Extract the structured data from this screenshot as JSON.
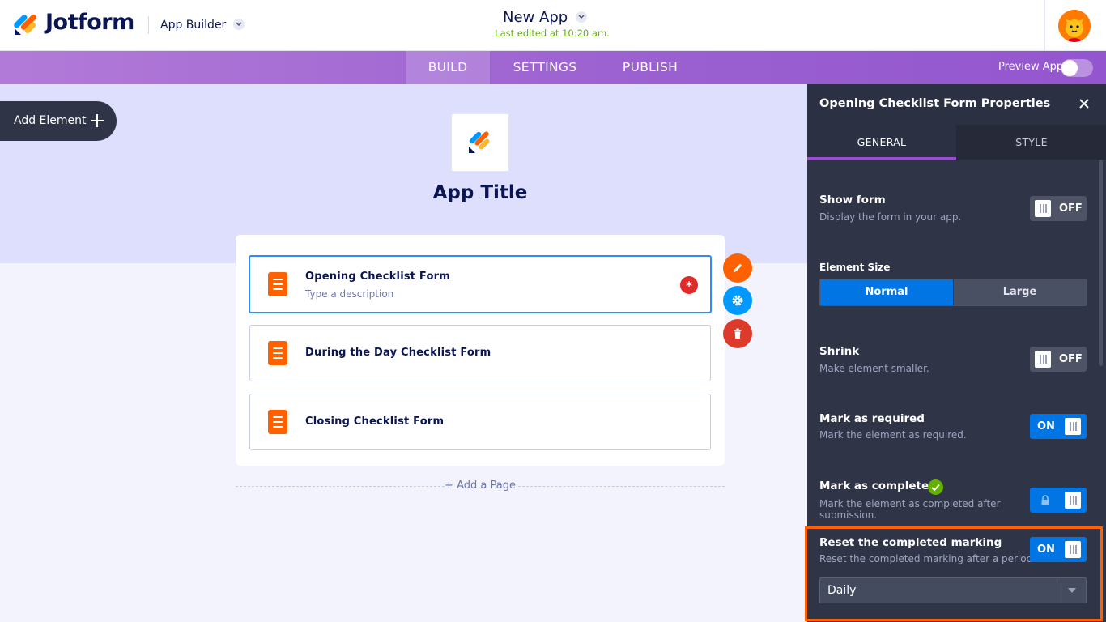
{
  "header": {
    "brand": "Jotform",
    "app_builder_label": "App Builder",
    "app_name": "New App",
    "last_edited": "Last edited at 10:20 am."
  },
  "nav": {
    "tabs": [
      {
        "label": "BUILD",
        "active": true
      },
      {
        "label": "SETTINGS",
        "active": false
      },
      {
        "label": "PUBLISH",
        "active": false
      }
    ],
    "preview_label": "Preview App"
  },
  "canvas": {
    "add_element_label": "Add Element",
    "app_title": "App Title",
    "items": [
      {
        "title": "Opening Checklist Form",
        "description": "Type a description",
        "selected": true
      },
      {
        "title": "During the Day Checklist Form",
        "description": "",
        "selected": false
      },
      {
        "title": "Closing Checklist Form",
        "description": "",
        "selected": false
      }
    ],
    "required_mark": "*",
    "add_page_label": "+ Add a Page"
  },
  "panel": {
    "title": "Opening Checklist Form Properties",
    "tabs": [
      {
        "label": "GENERAL",
        "active": true
      },
      {
        "label": "STYLE",
        "active": false
      }
    ],
    "show_form": {
      "title": "Show form",
      "desc": "Display the form in your app.",
      "state": "OFF"
    },
    "element_size": {
      "title": "Element Size",
      "options": [
        "Normal",
        "Large"
      ],
      "selected": "Normal"
    },
    "shrink": {
      "title": "Shrink",
      "desc": "Make element smaller.",
      "state": "OFF"
    },
    "mark_required": {
      "title": "Mark as required",
      "desc": "Mark the element as required.",
      "state": "ON"
    },
    "mark_completed": {
      "title": "Mark as completed",
      "desc": "Mark the element as completed after submission.",
      "state": "locked"
    },
    "reset_completed": {
      "title": "Reset the completed marking",
      "desc": "Reset the completed marking after a period.",
      "state": "ON",
      "period": "Daily"
    }
  },
  "colors": {
    "accent_purple": "#9c4dd3",
    "toggle_on": "#0075e3",
    "brand_orange": "#ff6100",
    "success_green": "#64b200",
    "danger_red": "#dc3a2b"
  }
}
